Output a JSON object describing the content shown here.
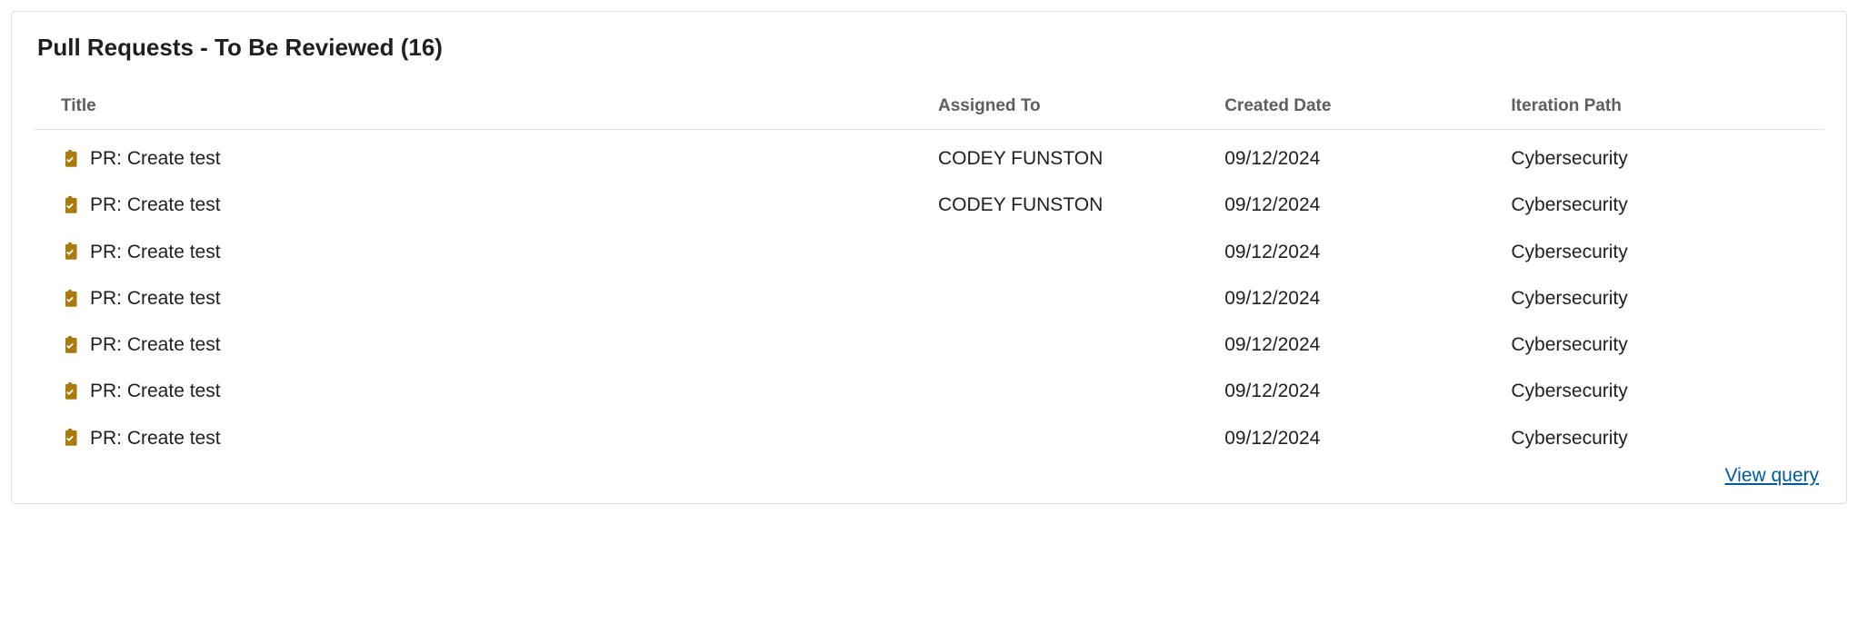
{
  "panel": {
    "title": "Pull Requests - To Be Reviewed (16)",
    "view_query": "View query"
  },
  "columns": {
    "title": "Title",
    "assigned_to": "Assigned To",
    "created_date": "Created Date",
    "iteration_path": "Iteration Path"
  },
  "rows": [
    {
      "title": "PR: Create test",
      "assigned_to": "CODEY FUNSTON",
      "created_date": "09/12/2024",
      "iteration_path": "Cybersecurity"
    },
    {
      "title": "PR: Create test",
      "assigned_to": "CODEY FUNSTON",
      "created_date": "09/12/2024",
      "iteration_path": "Cybersecurity"
    },
    {
      "title": "PR: Create test",
      "assigned_to": "",
      "created_date": "09/12/2024",
      "iteration_path": "Cybersecurity"
    },
    {
      "title": "PR: Create test",
      "assigned_to": "",
      "created_date": "09/12/2024",
      "iteration_path": "Cybersecurity"
    },
    {
      "title": "PR: Create test",
      "assigned_to": "",
      "created_date": "09/12/2024",
      "iteration_path": "Cybersecurity"
    },
    {
      "title": "PR: Create test",
      "assigned_to": "",
      "created_date": "09/12/2024",
      "iteration_path": "Cybersecurity"
    },
    {
      "title": "PR: Create test",
      "assigned_to": "",
      "created_date": "09/12/2024",
      "iteration_path": "Cybersecurity"
    }
  ],
  "icon_color": "#a97b0c"
}
